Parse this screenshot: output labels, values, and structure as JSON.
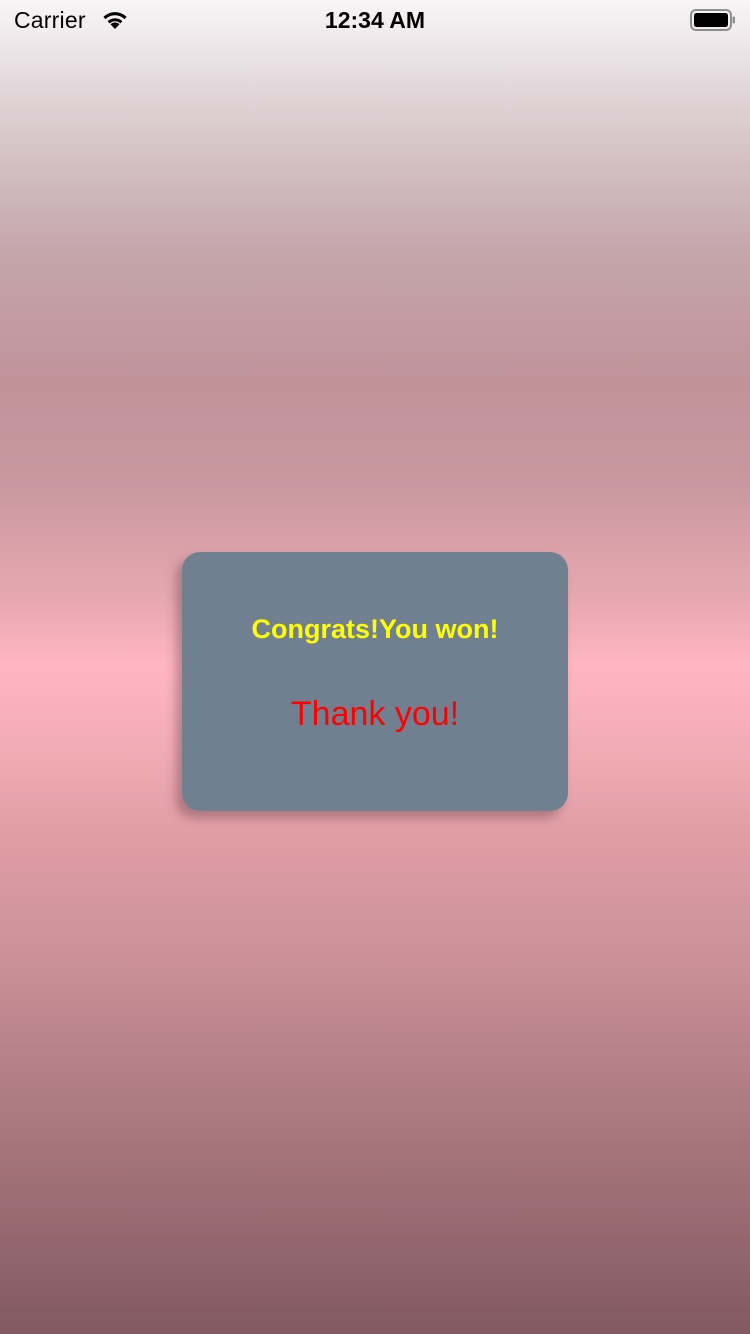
{
  "status_bar": {
    "carrier": "Carrier",
    "time": "12:34 AM",
    "icons": [
      "wifi-icon",
      "battery-icon"
    ]
  },
  "alert": {
    "title": "Congrats!You won!",
    "message": "Thank you!"
  },
  "colors": {
    "card_background": "#718090",
    "title_color": "#ffff00",
    "message_color": "#ff0000",
    "background_center": "#ffb6c1"
  }
}
